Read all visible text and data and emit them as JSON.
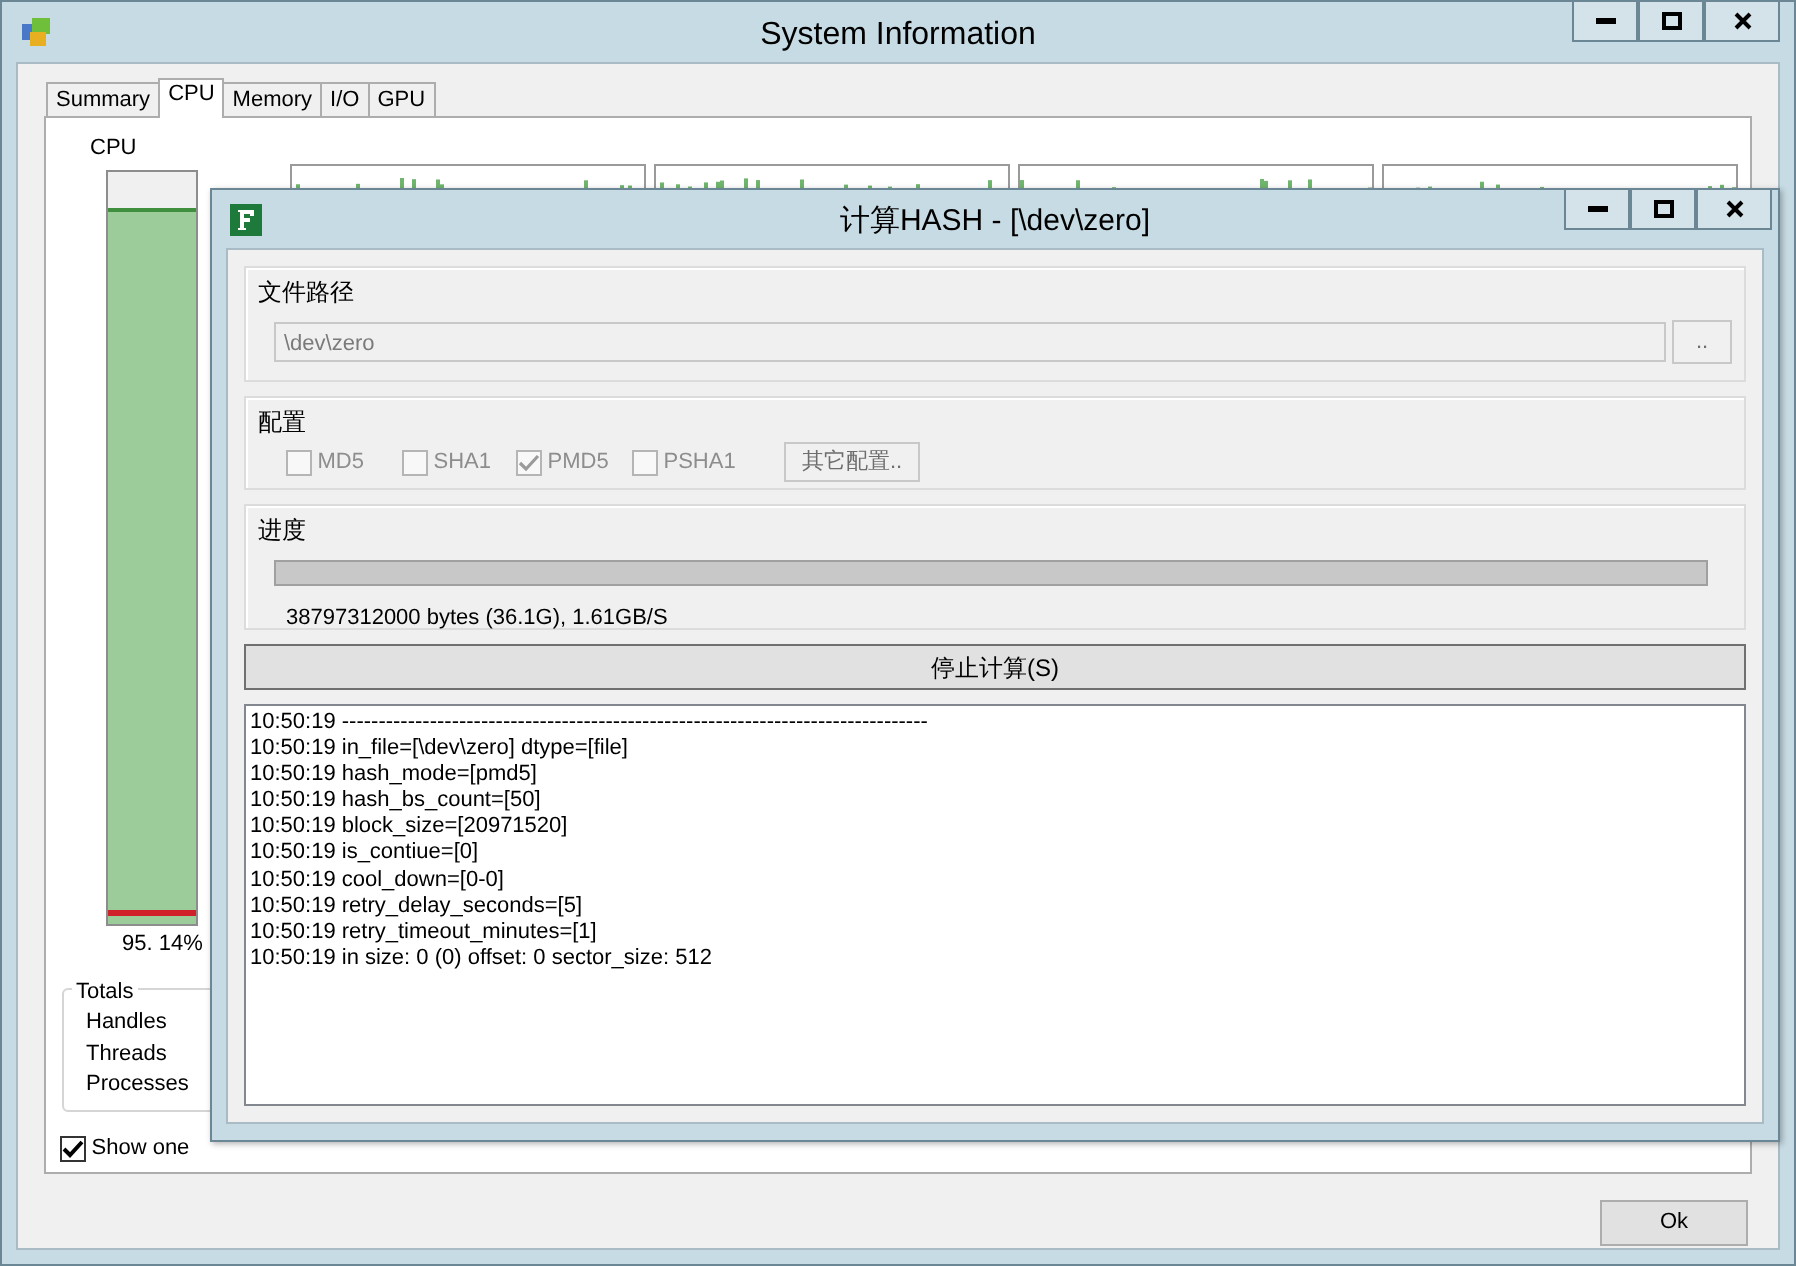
{
  "window": {
    "title": "System Information"
  },
  "tabs": [
    {
      "label": "Summary",
      "selected": false
    },
    {
      "label": "CPU",
      "selected": true
    },
    {
      "label": "Memory",
      "selected": false
    },
    {
      "label": "I/O",
      "selected": false
    },
    {
      "label": "GPU",
      "selected": false
    }
  ],
  "cpu_panel": {
    "label": "CPU",
    "level": 0.95,
    "reading": "95. 14%"
  },
  "totals": {
    "title": "Totals",
    "rows": [
      "Handles",
      "Threads",
      "Processes"
    ]
  },
  "show_one_graph": {
    "label": "Show one",
    "checked": true
  },
  "ok_button": "Ok",
  "dialog": {
    "title": "计算HASH - [\\dev\\zero]",
    "path_group": {
      "title": "文件路径",
      "value": "\\dev\\zero",
      "disabled": true,
      "browse_button": ".."
    },
    "config_group": {
      "title": "配置",
      "options": [
        {
          "label": "MD5",
          "checked": false,
          "disabled": true
        },
        {
          "label": "SHA1",
          "checked": false,
          "disabled": true
        },
        {
          "label": "PMD5",
          "checked": true,
          "disabled": true
        },
        {
          "label": "PSHA1",
          "checked": false,
          "disabled": true
        }
      ],
      "more_button": "其它配置.."
    },
    "progress_group": {
      "title": "进度",
      "level": 1,
      "status": "38797312000 bytes (36.1G), 1.61GB/S"
    },
    "stop_button": "停止计算(S)",
    "log": [
      "10:50:19 --------------------------------------------------------------------------------",
      "10:50:19 in_file=[\\dev\\zero] dtype=[file]",
      "10:50:19 hash_mode=[pmd5]",
      "10:50:19 hash_bs_count=[50]",
      "10:50:19 block_size=[20971520]",
      "10:50:19 is_contiue=[0]",
      "10:50:19 cool_down=[0-0]",
      "10:50:19 retry_delay_seconds=[5]",
      "10:50:19 retry_timeout_minutes=[1]",
      "10:50:19 in size: 0 (0) offset: 0 sector_size: 512"
    ]
  }
}
